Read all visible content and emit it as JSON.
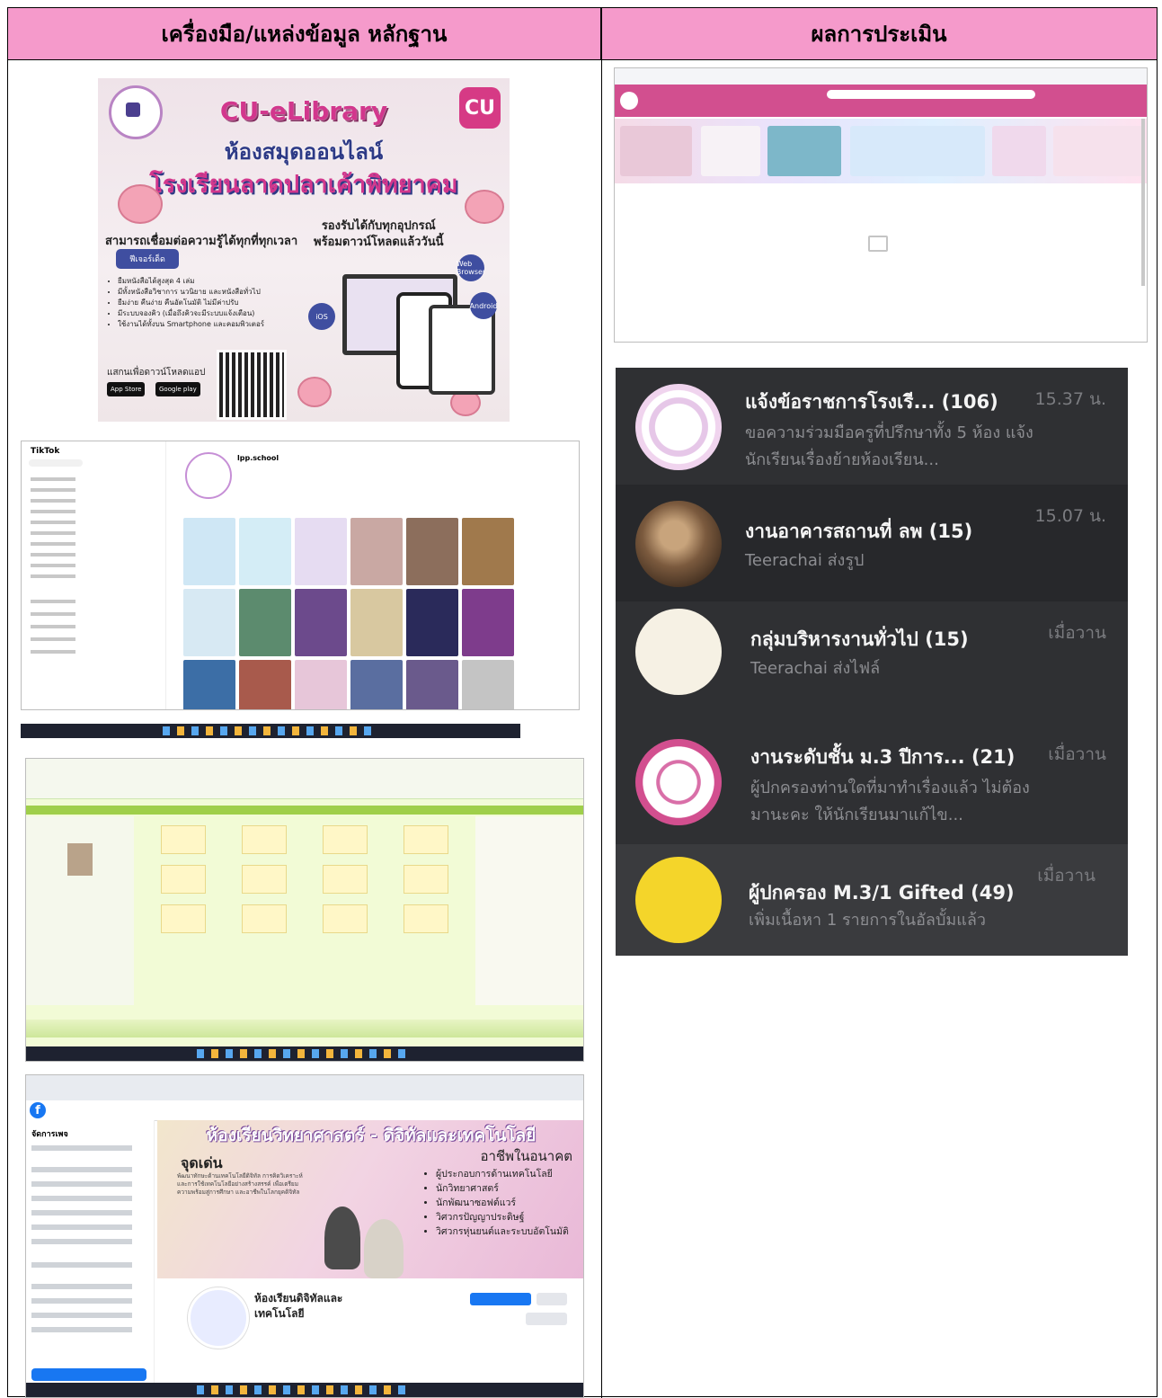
{
  "header": {
    "left": "เครื่องมือ/แหล่งข้อมูล หลักฐาน",
    "right": "ผลการประเมิน"
  },
  "poster": {
    "logo": "CU",
    "title1": "CU-eLibrary",
    "title2": "ห้องสมุดออนไลน์",
    "title3": "โรงเรียนลาดปลาเค้าพิทยาคม",
    "tag_left": "สามารถเชื่อมต่อความรู้ได้ทุกที่ทุกเวลา",
    "tag_right_1": "รองรับได้กับทุกอุปกรณ์",
    "tag_right_2": "พร้อมดาวน์โหลดแล้ววันนี้",
    "button": "ฟีเจอร์เด็ด",
    "features": [
      "ยืมหนังสือได้สูงสุด 4 เล่ม",
      "มีทั้งหนังสือวิชาการ นวนิยาย และหนังสือทั่วไป",
      "ยืมง่าย คืนง่าย คืนอัตโนมัติ ไม่มีค่าปรับ",
      "มีระบบจองคิว (เมื่อถึงคิวจะมีระบบแจ้งเตือน)",
      "ใช้งานได้ทั้งบน Smartphone และคอมพิวเตอร์"
    ],
    "scan": "แสกนเพื่อดาวน์โหลดแอป",
    "app_store": "App Store",
    "google_play": "Google play",
    "badges": [
      "Web Browser",
      "Android",
      "iOS"
    ]
  },
  "tiktok": {
    "logo": "TikTok",
    "username": "lpp.school"
  },
  "facebook": {
    "logo": "f",
    "cover_title": "ห้องเรียนวิทยาศาสตร์ - ดิจิทัลและเทคโนโลยี",
    "highlight": "จุดเด่น",
    "highlight_text": "พัฒนาทักษะด้านเทคโนโลยีดิจิทัล การคิดวิเคราะห์ และการใช้เทคโนโลยีอย่างสร้างสรรค์ เพื่อเตรียมความพร้อมสู่การศึกษา และอาชีพในโลกยุคดิจิทัล",
    "career_title": "อาชีพในอนาคต",
    "careers": [
      "ผู้ประกอบการด้านเทคโนโลยี",
      "นักวิทยาศาสตร์",
      "นักพัฒนาซอฟต์แวร์",
      "วิศวกรปัญญาประดิษฐ์",
      "วิศวกรหุ่นยนต์และระบบอัตโนมัติ"
    ],
    "sidebar_title": "จัดการเพจ",
    "page_name_1": "ห้องเรียนดิจิทัลและ",
    "page_name_2": "เทคโนโลยี"
  },
  "line_chats": [
    {
      "title": "แจ้งข้อราชการโรงเรี... (106)",
      "time": "15.37 น.",
      "msg": "ขอความร่วมมือครูที่ปรึกษาทั้ง 5 ห้อง แจ้งนักเรียนเรื่องย้ายห้องเรียน..."
    },
    {
      "title": "งานอาคารสถานที่ ลพ (15)",
      "time": "15.07 น.",
      "msg": "Teerachai ส่งรูป"
    },
    {
      "title": "กลุ่มบริหารงานทั่วไป (15)",
      "time": "เมื่อวาน",
      "msg": "Teerachai ส่งไฟล์"
    },
    {
      "title": "งานระดับชั้น ม.3 ปีการ... (21)",
      "time": "เมื่อวาน",
      "msg": "ผู้ปกครองท่านใดที่มาทำเรื่องแล้ว ไม่ต้องมานะคะ ให้นักเรียนมาแก้ไข..."
    },
    {
      "title": "ผู้ปกครอง M.3/1 Gifted (49)",
      "time": "เมื่อวาน",
      "msg": "เพิ่มเนื้อหา 1 รายการในอัลบั้มแล้ว"
    }
  ]
}
